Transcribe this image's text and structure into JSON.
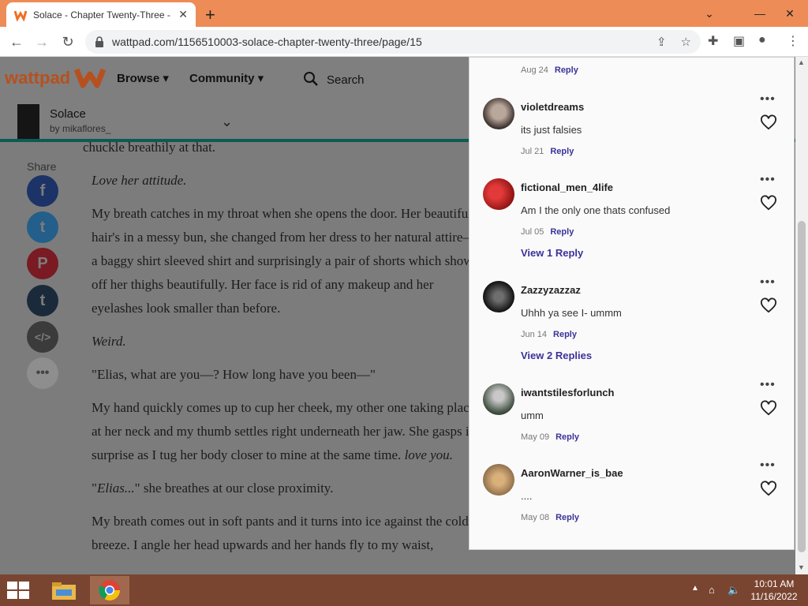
{
  "browser": {
    "tab_title": "Solace - Chapter Twenty-Three -",
    "url": "wattpad.com/1156510003-solace-chapter-twenty-three/page/15"
  },
  "header": {
    "logo": "wattpad",
    "nav": [
      "Browse",
      "Community"
    ],
    "search_label": "Search"
  },
  "story": {
    "title": "Solace",
    "author": "by mikaflores_"
  },
  "share": {
    "label": "Share",
    "buttons": [
      "facebook-icon",
      "twitter-icon",
      "pinterest-icon",
      "tumblr-icon",
      "embed-icon",
      "more-icon"
    ]
  },
  "reader": {
    "p0": "chuckle breathily at that.",
    "p1": "Love her attitude.",
    "p2": "My breath catches in my throat when she opens the door. Her beautiful hair's in a messy bun, she changed from her dress to her natural attire— a baggy shirt sleeved shirt and surprisingly a pair of shorts which show off her thighs beautifully. Her face is rid of any makeup and her eyelashes look smaller than before.",
    "p3": "Weird.",
    "p4": "\"Elias, what are you—? How long have you been—\"",
    "p5a": "My hand quickly comes up to cup her cheek, my other one taking place at her neck and my thumb settles right underneath her jaw. She gasps in surprise as I tug her body closer to mine at the same time.",
    "p5b": "love you.",
    "p6a": "\"",
    "p6b": "Elias...",
    "p6c": "\" she breathes at our close proximity.",
    "p7": "My breath comes out in soft pants and it turns into ice against the cold breeze. I angle her head upwards and her hands fly to my waist,"
  },
  "comments": {
    "reply_label": "Reply",
    "top_date": "Aug 24",
    "items": [
      {
        "user": "violetdreams",
        "text": "its just falsies",
        "date": "Jul 21",
        "view": ""
      },
      {
        "user": "fictional_men_4life",
        "text": "Am I the only one thats confused",
        "date": "Jul 05",
        "view": "View 1 Reply"
      },
      {
        "user": "Zazzyzazzaz",
        "text": "Uhhh ya see I- ummm",
        "date": "Jun 14",
        "view": "View 2 Replies"
      },
      {
        "user": "iwantstilesforlunch",
        "text": "umm",
        "date": "May 09",
        "view": ""
      },
      {
        "user": "AaronWarner_is_bae",
        "text": "....",
        "date": "May 08",
        "view": ""
      }
    ]
  },
  "taskbar": {
    "time": "10:01 AM",
    "date": "11/16/2022"
  }
}
